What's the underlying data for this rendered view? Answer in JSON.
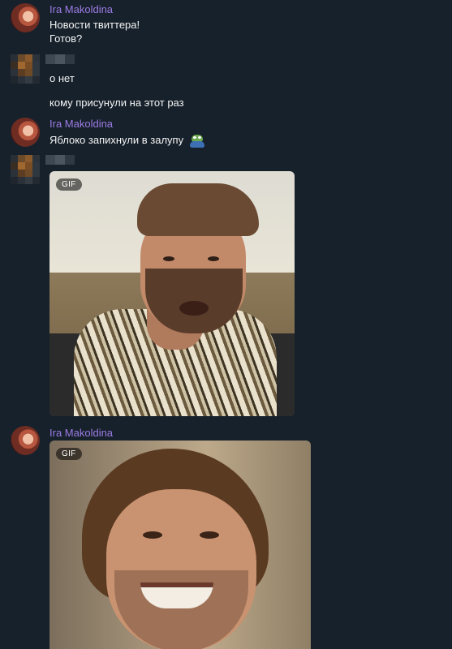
{
  "messages": [
    {
      "sender": "Ira Makoldina",
      "lines": [
        "Новости твиттера!",
        "Готов?"
      ]
    },
    {
      "sender": "",
      "lines": [
        "о нет",
        "кому присунули на этот раз"
      ]
    },
    {
      "sender": "Ira Makoldina",
      "lines": [
        "Яблоко запихнули в залупу"
      ],
      "emoji": "pepe-frog-emoji"
    },
    {
      "sender": "",
      "gif": {
        "badge": "GIF"
      }
    },
    {
      "sender": "Ira Makoldina",
      "gif": {
        "badge": "GIF"
      }
    }
  ],
  "colors": {
    "background": "#17212b",
    "sender_name": "#9d7ce6",
    "text": "#f5f5f5"
  }
}
